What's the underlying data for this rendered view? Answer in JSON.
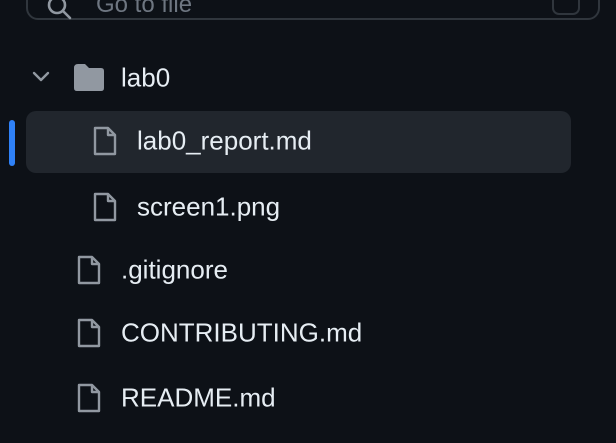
{
  "search": {
    "placeholder": "Go to file"
  },
  "tree": {
    "folder": {
      "name": "lab0",
      "expanded": true,
      "icon": "folder-icon",
      "children": [
        {
          "name": "lab0_report.md",
          "icon": "file-icon",
          "selected": true
        },
        {
          "name": "screen1.png",
          "icon": "file-icon",
          "selected": false
        }
      ]
    },
    "files": [
      {
        "name": ".gitignore",
        "icon": "file-icon"
      },
      {
        "name": "CONTRIBUTING.md",
        "icon": "file-icon"
      },
      {
        "name": "README.md",
        "icon": "file-icon"
      }
    ]
  },
  "colors": {
    "background": "#0d1117",
    "text": "#e6edf3",
    "icon": "#9198a1",
    "selected_row": "#21262d",
    "active_marker": "#2f81f7",
    "border": "#30363d"
  }
}
